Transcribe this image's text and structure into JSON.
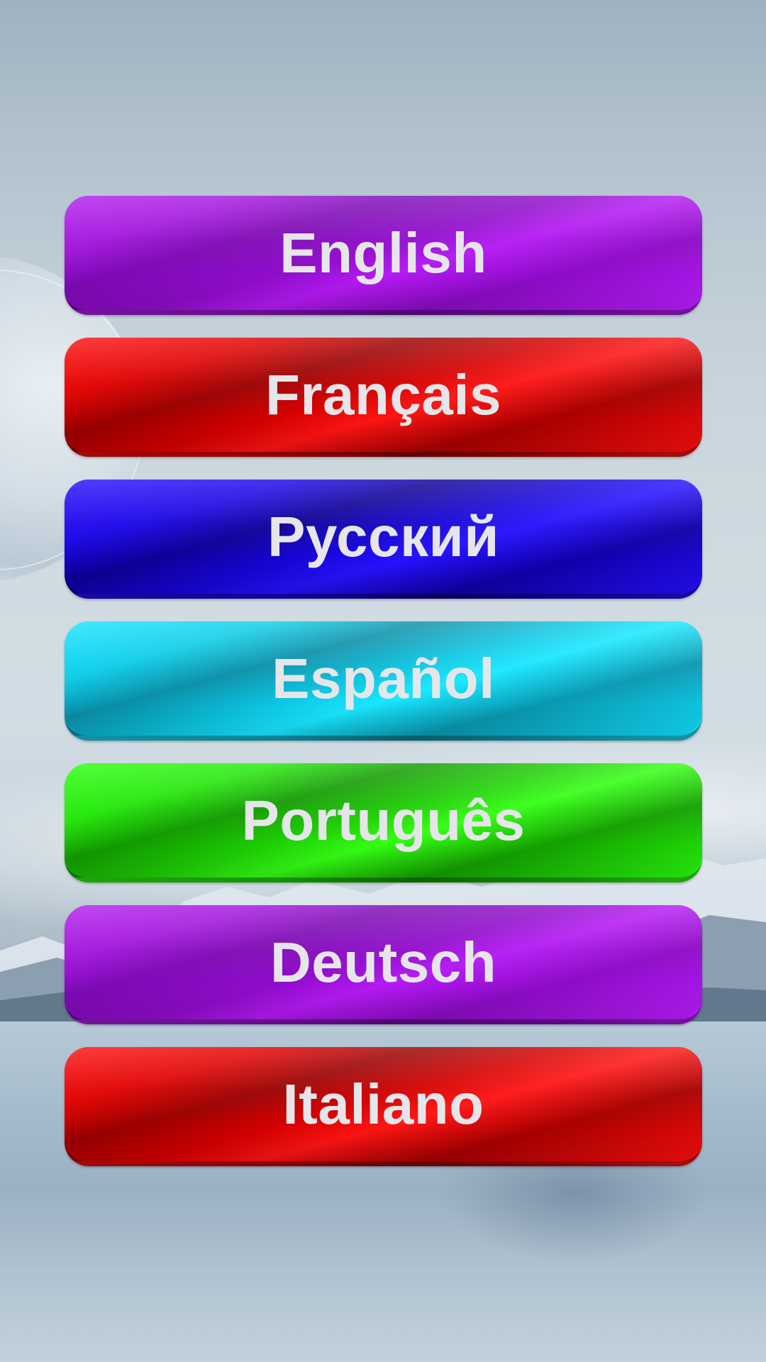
{
  "background": {
    "scene": "lake-with-mountains-and-planet"
  },
  "languages": [
    {
      "label": "English",
      "color": "#b41ef0"
    },
    {
      "label": "Français",
      "color": "#ff1010"
    },
    {
      "label": "Русский",
      "color": "#2a10ff"
    },
    {
      "label": "Español",
      "color": "#16e4ff"
    },
    {
      "label": "Português",
      "color": "#2cff0e"
    },
    {
      "label": "Deutsch",
      "color": "#b41ef0"
    },
    {
      "label": "Italiano",
      "color": "#ff1010"
    }
  ],
  "label_color": "#e6e6ea"
}
